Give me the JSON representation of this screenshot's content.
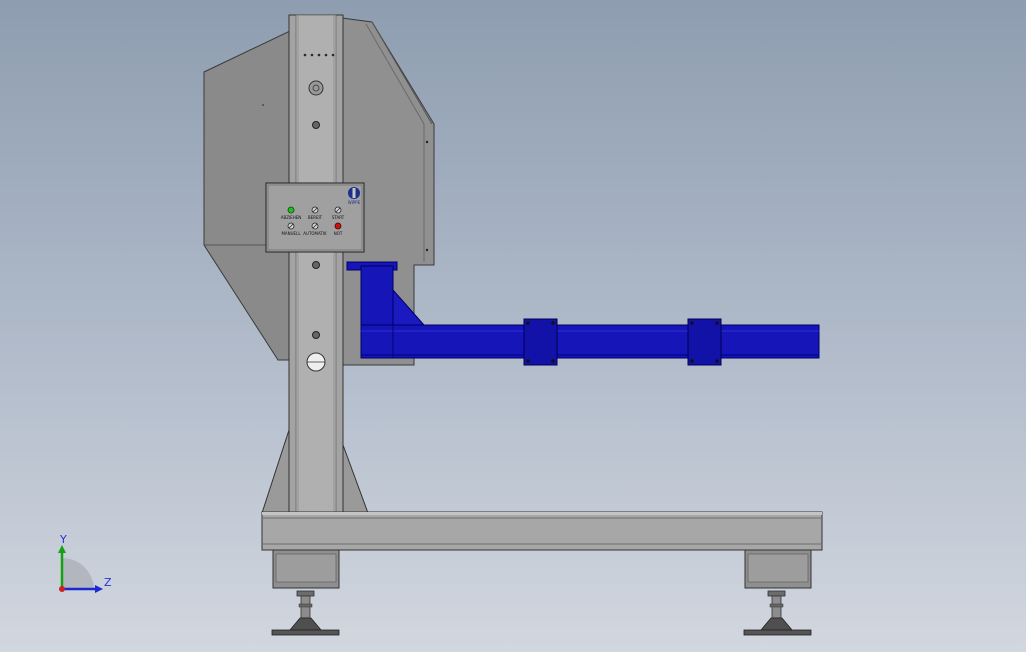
{
  "viewport": {
    "background_top": "#8e9db0",
    "background_bottom": "#d2d7df"
  },
  "colors": {
    "frame_grey": "#9b9b9b",
    "hopper_grey": "#8a8a8a",
    "arm_blue": "#1515b8",
    "indicator_green": "#22bb22",
    "indicator_red": "#cc1111"
  },
  "control_panel": {
    "logo_text": "WIPPE",
    "row1": [
      {
        "label": "ABZIEHEN",
        "indicator": "green"
      },
      {
        "label": "BEREIT",
        "indicator": "switch"
      },
      {
        "label": "START",
        "indicator": "switch"
      }
    ],
    "row2": [
      {
        "label": "MANUELL",
        "indicator": "switch"
      },
      {
        "label": "AUTOMATIK",
        "indicator": "switch"
      },
      {
        "label": "NOT",
        "indicator": "red"
      }
    ]
  },
  "triad": {
    "y_label": "Y",
    "z_label": "Z",
    "icon": "coordinate-axis-triad-icon"
  }
}
